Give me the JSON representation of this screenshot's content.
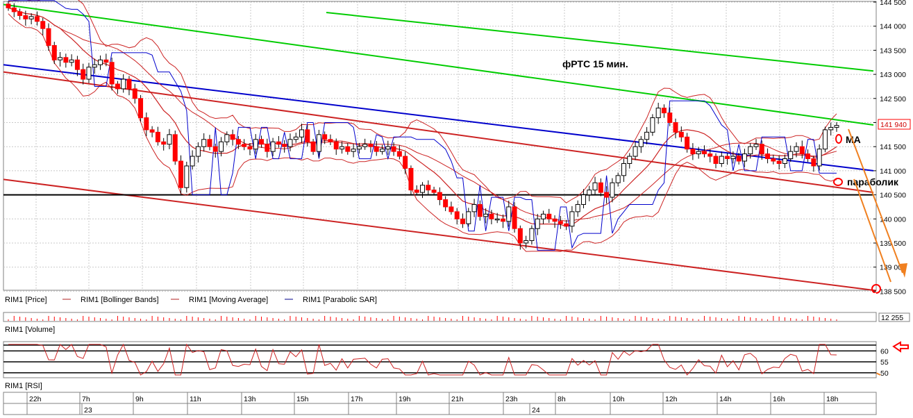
{
  "chart_data": {
    "type": "candlestick",
    "title": "фРТС   15 мин.",
    "instrument": "RIM1",
    "y_axis": {
      "range": [
        138400,
        144500
      ],
      "ticks": [
        "144 500",
        "144 000",
        "143 500",
        "143 000",
        "142 500",
        "142 000",
        "141 500",
        "141 000",
        "140 500",
        "140 000",
        "139 500",
        "139 000",
        "138 500"
      ],
      "tick_values": [
        144500,
        144000,
        143500,
        143000,
        142500,
        142000,
        141500,
        141000,
        140500,
        140000,
        139500,
        139000,
        138500
      ],
      "current_price_label": "141 940",
      "current_price": 141940
    },
    "x_axis": {
      "time_labels": [
        "22h",
        "7h",
        "9h",
        "11h",
        "13h",
        "15h",
        "17h",
        "19h",
        "21h",
        "23h",
        "8h",
        "10h",
        "12h",
        "14h",
        "16h",
        "18h"
      ],
      "date_labels": [
        "23",
        "24"
      ]
    },
    "legend": [
      {
        "label": "RIM1 [Price]",
        "color": "#000000"
      },
      {
        "label": "RIM1 [Bollinger Bands]",
        "color": "#b22222"
      },
      {
        "label": "RIM1 [Moving Average]",
        "color": "#b22222"
      },
      {
        "label": "RIM1 [Parabolic SAR]",
        "color": "#00008b"
      }
    ],
    "candles_close": [
      144380,
      144300,
      144220,
      144150,
      144200,
      144100,
      143950,
      143600,
      143300,
      143350,
      143250,
      143300,
      143100,
      142900,
      143150,
      143200,
      143300,
      143250,
      142800,
      142700,
      142900,
      142700,
      142500,
      142100,
      141850,
      141800,
      141600,
      141550,
      141750,
      141200,
      140650,
      141100,
      141300,
      141500,
      141650,
      141500,
      141400,
      141600,
      141750,
      141650,
      141550,
      141500,
      141450,
      141650,
      141550,
      141400,
      141600,
      141550,
      141500,
      141650,
      141700,
      141850,
      141600,
      141400,
      141750,
      141650,
      141600,
      141450,
      141500,
      141400,
      141450,
      141500,
      141550,
      141500,
      141400,
      141450,
      141500,
      141400,
      141300,
      141050,
      140600,
      140550,
      140700,
      140600,
      140550,
      140400,
      140250,
      140150,
      140000,
      139900,
      140150,
      140300,
      140050,
      140100,
      140000,
      140000,
      139950,
      140250,
      139800,
      139500,
      139550,
      139800,
      140000,
      140100,
      140000,
      139950,
      139900,
      139850,
      140150,
      140300,
      140500,
      140600,
      140750,
      140550,
      140450,
      140750,
      140900,
      141150,
      141300,
      141500,
      141650,
      141800,
      142100,
      142300,
      142200,
      142000,
      141800,
      141700,
      141450,
      141350,
      141400,
      141350,
      141300,
      141150,
      141300,
      141250,
      141300,
      141200,
      141350,
      141500,
      141550,
      141350,
      141250,
      141200,
      141150,
      141250,
      141400,
      141500,
      141350,
      141250,
      141100,
      141450,
      141850,
      141900,
      141940
    ],
    "rsi_levels": [
      60,
      55,
      50
    ],
    "volume_label": "12 255",
    "panel_labels": {
      "volume": "RIM1 [Volume]",
      "rsi": "RIM1 [RSI]"
    },
    "annotations": {
      "ma": "МА",
      "parabolic": "параболик"
    },
    "colors": {
      "up_candle": "#ffffff",
      "down_candle": "#ff0000",
      "channel_green": "#00cc00",
      "channel_red": "#cc2222",
      "trend_blue": "#0000cc",
      "support_black": "#000000",
      "forecast_arrow": "#f08020"
    }
  }
}
